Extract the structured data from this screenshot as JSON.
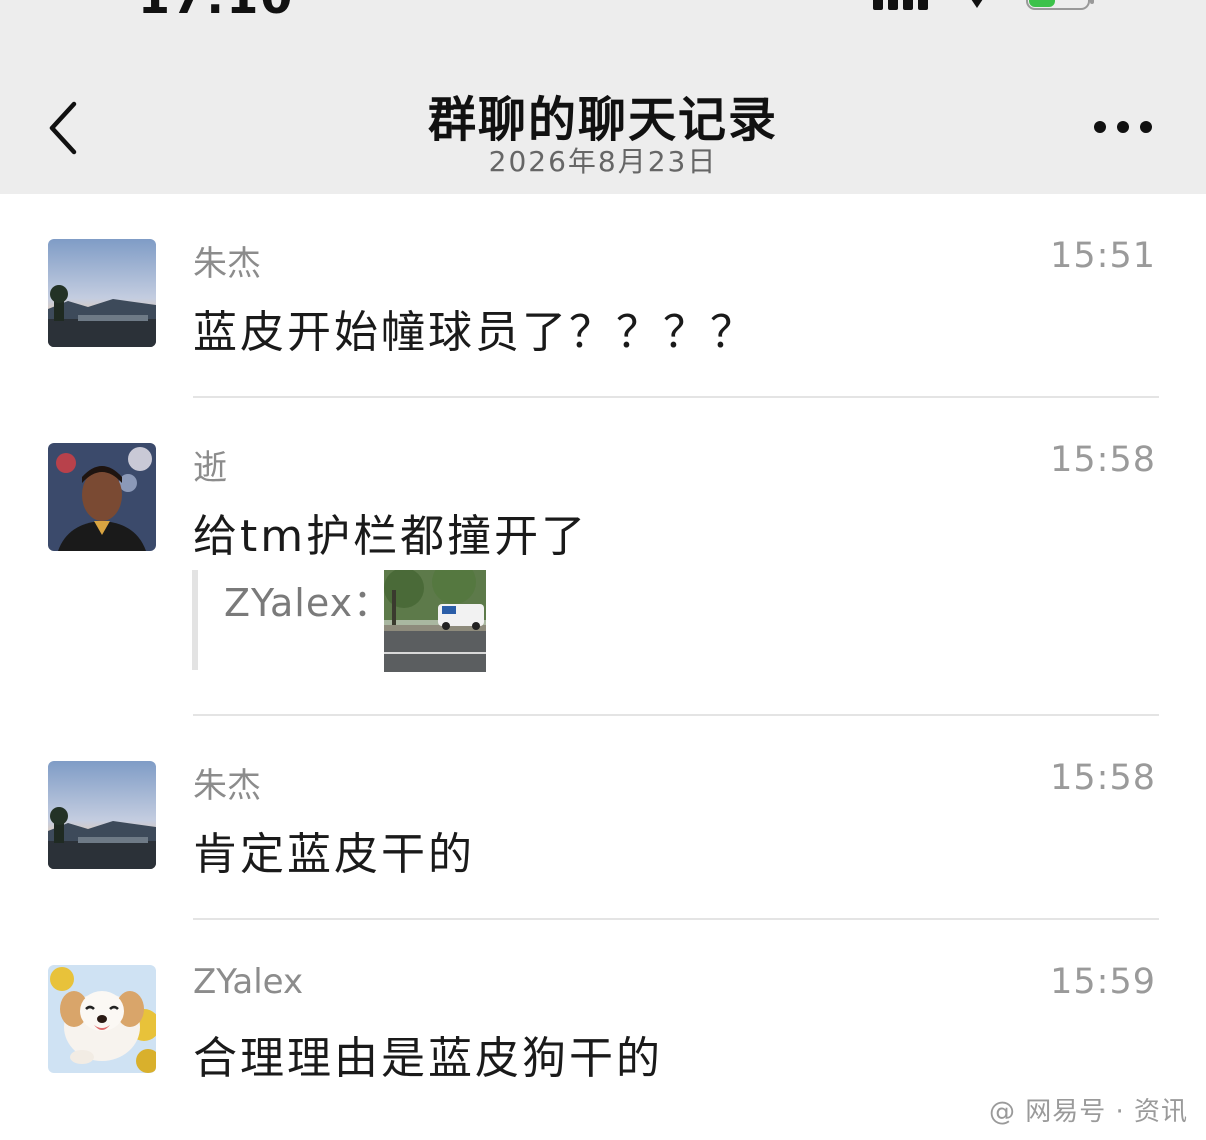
{
  "nav": {
    "title": "群聊的聊天记录",
    "subtitle": "2026年8月23日",
    "back_icon": "chevron-left-icon",
    "more_icon": "more-horizontal-icon"
  },
  "messages": [
    {
      "sender": "朱杰",
      "time": "15:51",
      "text": "蓝皮开始幢球员了？？？？",
      "avatar": "landscape-sunset-avatar"
    },
    {
      "sender": "逝",
      "time": "15:58",
      "text": "给tm护栏都撞开了",
      "avatar": "football-player-avatar",
      "quote": {
        "label": "ZYalex：",
        "image": "street-police-car-photo"
      }
    },
    {
      "sender": "朱杰",
      "time": "15:58",
      "text": "肯定蓝皮干的",
      "avatar": "landscape-sunset-avatar"
    },
    {
      "sender": "ZYalex",
      "time": "15:59",
      "text": "合理理由是蓝皮狗干的",
      "avatar": "puppy-avatar"
    }
  ],
  "colors": {
    "nav_background": "#ededed",
    "divider": "#e4e4e4",
    "sender_gray": "#8c8c8c"
  }
}
